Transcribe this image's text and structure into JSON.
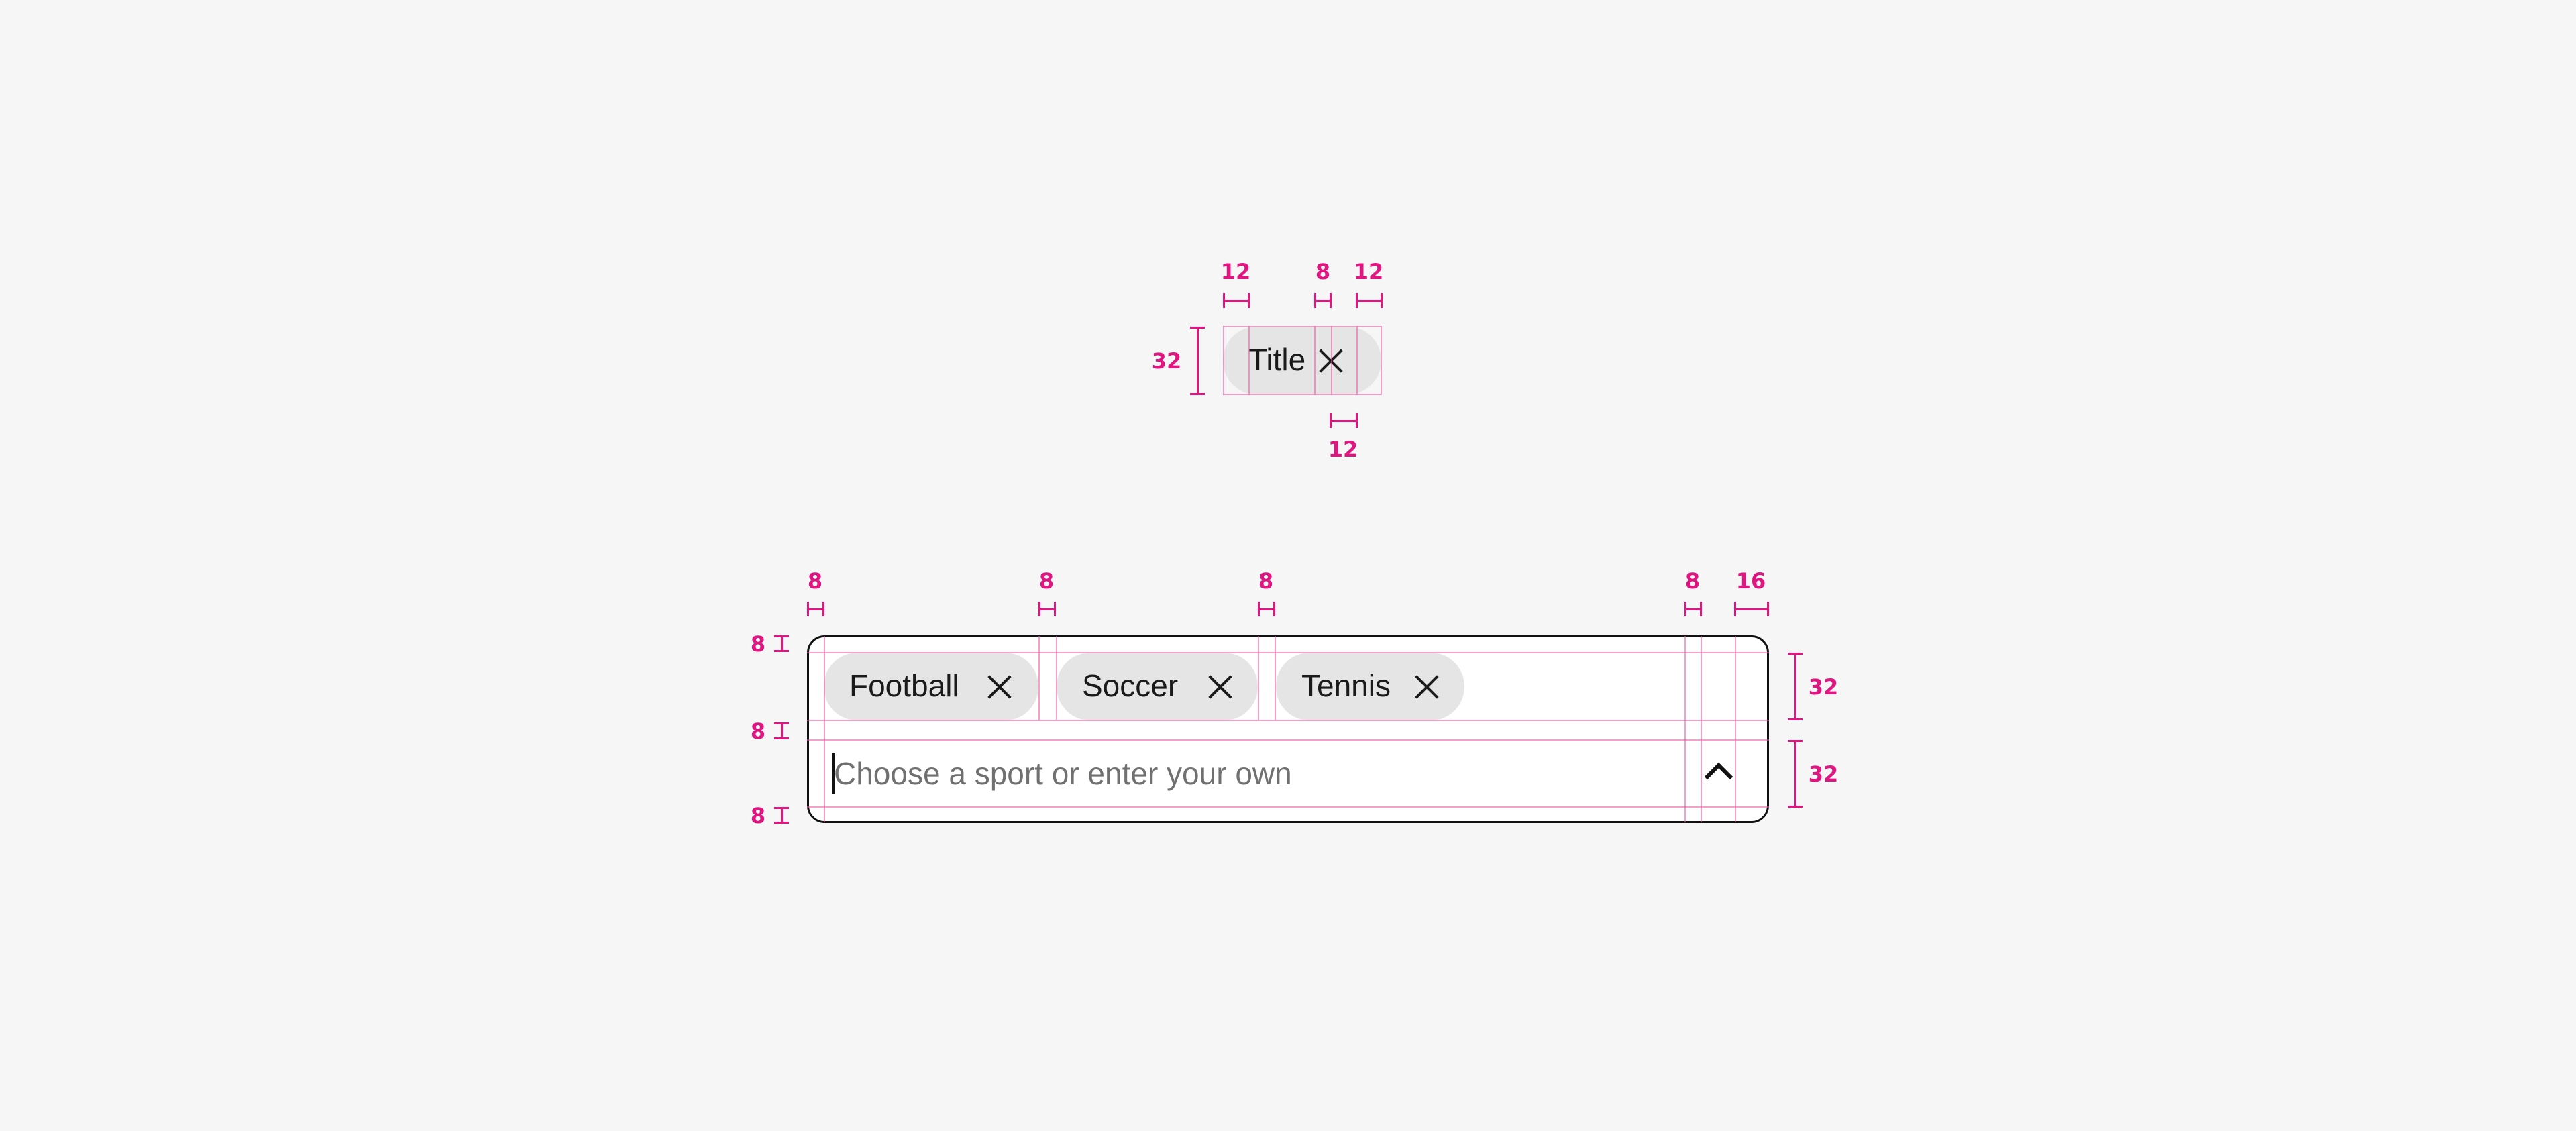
{
  "anatomy_chip": {
    "title": "Title",
    "remove_icon": "close-icon",
    "measurements": {
      "height": "32",
      "leading_padding": "12",
      "icon_gap": "8",
      "trailing_padding": "12",
      "icon_size": "12"
    }
  },
  "multi_select_field": {
    "chips": [
      {
        "label": "Football",
        "remove_icon": "close-icon"
      },
      {
        "label": "Soccer",
        "remove_icon": "close-icon"
      },
      {
        "label": "Tennis",
        "remove_icon": "close-icon"
      }
    ],
    "input": {
      "placeholder": "Choose a sport or enter your own",
      "value": ""
    },
    "toggle_icon": "chevron-up-icon",
    "measurements": {
      "left_padding": "8",
      "chip_gap_1": "8",
      "chip_gap_2": "8",
      "icon_gap": "8",
      "right_padding": "16",
      "top_padding": "8",
      "row_gap": "8",
      "bottom_padding": "8",
      "chip_row_height": "32",
      "input_row_height": "32"
    }
  },
  "colors": {
    "annotation": "#e0157f",
    "chip_background": "#e5e5e5",
    "background": "#f6f6f6",
    "field_border": "#111111",
    "placeholder": "#707070"
  }
}
